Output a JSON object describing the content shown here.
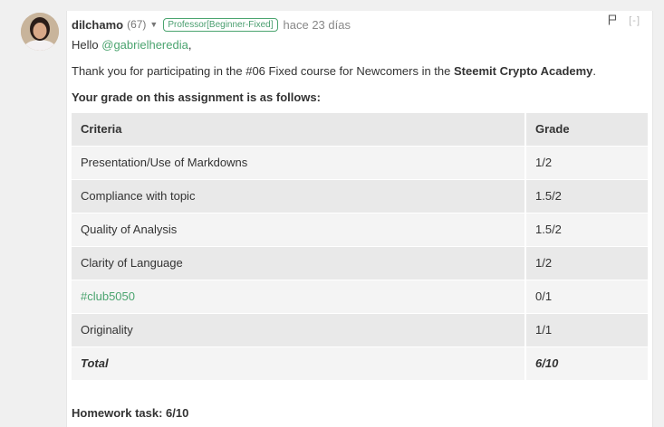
{
  "comment": {
    "author": "dilchamo",
    "reputation": "(67)",
    "badge": "Professor[Beginner-Fixed]",
    "time_ago": "hace 23 días",
    "collapse_label": "[-]",
    "greeting_prefix": "Hello",
    "mention": "@gabrielheredia",
    "greeting_suffix": ",",
    "thanks_prefix": "Thank you for participating in the #06 Fixed course for Newcomers in the",
    "thanks_bold": "Steemit Crypto Academy",
    "thanks_suffix": ".",
    "grade_intro": "Your grade on this assignment is as follows:",
    "homework": "Homework task: 6/10"
  },
  "table": {
    "headers": [
      "Criteria",
      "Grade"
    ],
    "rows": [
      {
        "criteria": "Presentation/Use of Markdowns",
        "grade": "1/2"
      },
      {
        "criteria": "Compliance with topic",
        "grade": "1.5/2"
      },
      {
        "criteria": "Quality of Analysis",
        "grade": "1.5/2"
      },
      {
        "criteria": "Clarity of Language",
        "grade": "1/2"
      },
      {
        "criteria": "#club5050",
        "grade": "0/1"
      },
      {
        "criteria": "Originality",
        "grade": "1/1"
      }
    ],
    "total": {
      "criteria": "Total",
      "grade": "6/10"
    }
  },
  "colors": {
    "accent_green": "#4ba46f",
    "header_row": "#e8e8e8",
    "row_light": "#f4f4f4",
    "row_dark": "#e9e9e9"
  },
  "icons": {
    "avatar": "user-avatar",
    "caret": "chevron-down-icon",
    "flag": "flag-icon"
  }
}
